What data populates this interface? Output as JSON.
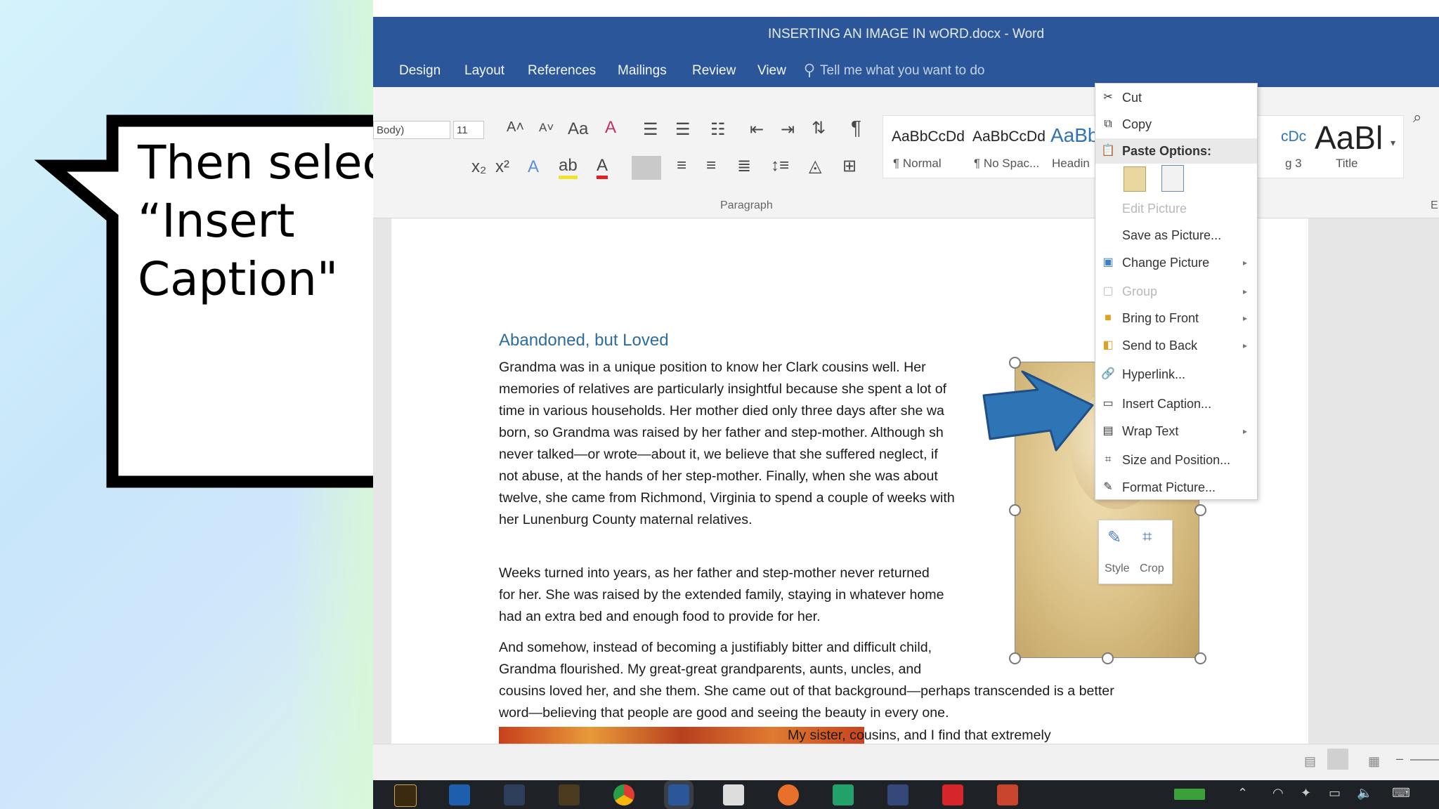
{
  "callout": {
    "text": "Then select\n“Insert\nCaption\""
  },
  "window": {
    "title": "INSERTING AN IMAGE IN wORD.docx  -  Word"
  },
  "tabs": [
    "Design",
    "Layout",
    "References",
    "Mailings",
    "Review",
    "View"
  ],
  "tell_me": "Tell me what you want to do",
  "ribbon": {
    "font_name": "Body)",
    "font_size": "11",
    "paragraph_group": "Paragraph",
    "styles": [
      {
        "sample": "AaBbCcDd",
        "name": "¶ Normal"
      },
      {
        "sample": "AaBbCcDd",
        "name": "¶ No Spac..."
      },
      {
        "sample": "AaBb",
        "name": "Headin"
      },
      {
        "sample": "cDc",
        "name": "g 3"
      },
      {
        "sample": "AaBl",
        "name": "Title"
      }
    ],
    "editing_group": "E"
  },
  "document": {
    "heading": "Abandoned, but Loved",
    "paragraphs": [
      "Grandma was in a unique position to know her Clark cousins well. Her\nmemories of relatives are particularly insightful because she spent a lot of\ntime in various households. Her mother died only three days after she wa\nborn, so Grandma was raised by her father and step-mother. Although sh\nnever talked—or wrote—about it, we believe that she suffered neglect, if\nnot abuse, at the hands of her step-mother. Finally, when she was about\ntwelve, she came from Richmond, Virginia to spend a couple of weeks with\nher Lunenburg County maternal relatives.",
      " Weeks turned into years, as her father and step-mother never returned\nfor her. She was raised by the extended family, staying in whatever home\nhad an extra bed and enough food to provide for her.",
      "And somehow, instead of becoming a justifiably bitter and difficult child,\nGrandma flourished. My great-great grandparents, aunts, uncles, and\ncousins loved her, and she them. She came out of that background—perhaps transcended is a better\nword—believing that people are good and seeing the beauty in every one.",
      "My sister, cousins, and I find that extremely"
    ]
  },
  "image_toolbar": {
    "style": "Style",
    "crop": "Crop"
  },
  "context_menu": {
    "items": [
      {
        "label": "Cut",
        "icon": "scissors-icon",
        "disabled": false,
        "submenu": false
      },
      {
        "label": "Copy",
        "icon": "copy-icon",
        "disabled": false,
        "submenu": false
      },
      {
        "label": "Paste Options:",
        "icon": "paste-icon",
        "disabled": false,
        "submenu": false,
        "header": true
      },
      {
        "label": "Edit Picture",
        "icon": "",
        "disabled": true,
        "submenu": false
      },
      {
        "label": "Save as Picture...",
        "icon": "",
        "disabled": false,
        "submenu": false
      },
      {
        "label": "Change Picture",
        "icon": "change-picture-icon",
        "disabled": false,
        "submenu": true
      },
      {
        "label": "Group",
        "icon": "group-icon",
        "disabled": true,
        "submenu": true
      },
      {
        "label": "Bring to Front",
        "icon": "bring-front-icon",
        "disabled": false,
        "submenu": true
      },
      {
        "label": "Send to Back",
        "icon": "send-back-icon",
        "disabled": false,
        "submenu": true
      },
      {
        "label": "Hyperlink...",
        "icon": "hyperlink-icon",
        "disabled": false,
        "submenu": false
      },
      {
        "label": "Insert Caption...",
        "icon": "insert-caption-icon",
        "disabled": false,
        "submenu": false
      },
      {
        "label": "Wrap Text",
        "icon": "wrap-text-icon",
        "disabled": false,
        "submenu": true
      },
      {
        "label": "Size and Position...",
        "icon": "size-position-icon",
        "disabled": false,
        "submenu": false
      },
      {
        "label": "Format Picture...",
        "icon": "format-picture-icon",
        "disabled": false,
        "submenu": false
      }
    ]
  },
  "colors": {
    "word_blue": "#2b579a",
    "arrow_blue": "#2e75b6",
    "heading_blue": "#2f6c9e"
  }
}
